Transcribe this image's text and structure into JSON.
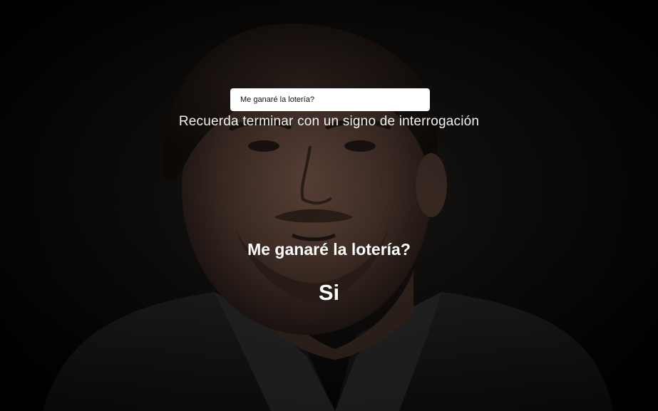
{
  "question_input": {
    "value": "Me ganaré la lotería?"
  },
  "hint_text": "Recuerda terminar con un signo de interrogación",
  "result": {
    "question": "Me ganaré la lotería?",
    "answer": "Si"
  },
  "colors": {
    "background": "#000000",
    "text": "#ffffff",
    "input_bg": "#ffffff"
  }
}
